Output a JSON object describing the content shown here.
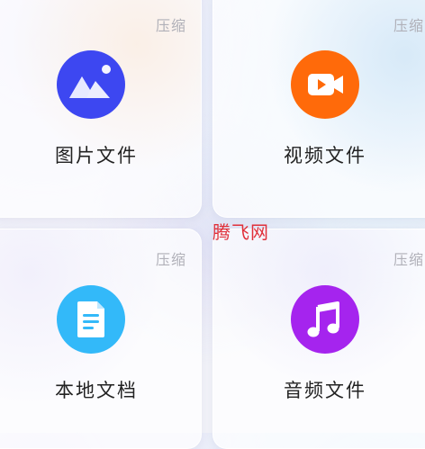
{
  "tiles": {
    "images": {
      "label": "图片文件",
      "badge": "压缩",
      "icon": "image-icon",
      "color": "#3d47f1"
    },
    "videos": {
      "label": "视频文件",
      "badge": "压缩",
      "icon": "video-icon",
      "color": "#ff6a0a"
    },
    "documents": {
      "label": "本地文档",
      "badge": "压缩",
      "icon": "document-icon",
      "color": "#33b9f9"
    },
    "audio": {
      "label": "音频文件",
      "badge": "压缩",
      "icon": "music-icon",
      "color": "#a524ee"
    }
  },
  "watermark": "腾飞网"
}
